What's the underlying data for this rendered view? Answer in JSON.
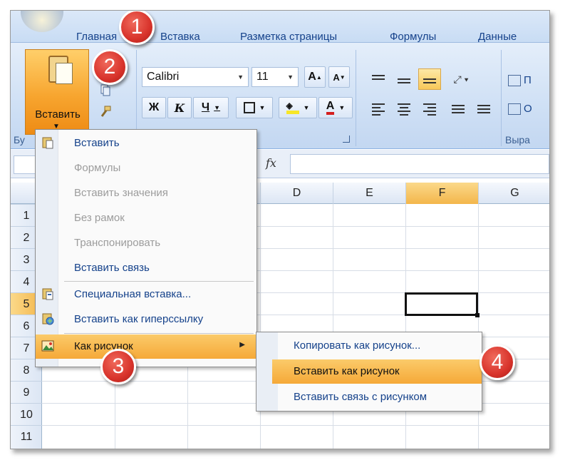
{
  "ribbon": {
    "tabs": [
      "Главная",
      "Вставка",
      "Разметка страницы",
      "Формулы",
      "Данные"
    ],
    "paste_button": "Вставить",
    "font_name": "Calibri",
    "font_size": "11",
    "grow_font": "A",
    "shrink_font": "A",
    "bold": "Ж",
    "italic": "К",
    "underline": "Ч",
    "clipboard_group_fragment": "Бу",
    "align_group_fragment": "Выра",
    "wrap_fragment": "П",
    "merge_fragment": "О",
    "font_color": "#d41f1f",
    "fill_color": "#f7e628"
  },
  "formula_bar": {
    "fx_label": "fx"
  },
  "grid": {
    "columns": [
      "D",
      "E",
      "F",
      "G"
    ],
    "selected_column": "F",
    "rows": [
      "1",
      "2",
      "3",
      "4",
      "5",
      "6",
      "7",
      "8",
      "9",
      "10",
      "11"
    ],
    "selected_row": "5"
  },
  "paste_menu": {
    "items": [
      {
        "label": "Вставить",
        "enabled": true,
        "icon": "paste-icon"
      },
      {
        "label": "Формулы",
        "enabled": false,
        "icon": ""
      },
      {
        "label": "Вставить значения",
        "enabled": false,
        "icon": ""
      },
      {
        "label": "Без рамок",
        "enabled": false,
        "icon": ""
      },
      {
        "label": "Транспонировать",
        "enabled": false,
        "icon": ""
      },
      {
        "label": "Вставить связь",
        "enabled": true,
        "icon": ""
      },
      {
        "label": "Специальная вставка...",
        "enabled": true,
        "icon": "paste-special-icon"
      },
      {
        "label": "Вставить как гиперссылку",
        "enabled": true,
        "icon": "paste-hyperlink-icon"
      },
      {
        "label": "Как рисунок",
        "enabled": true,
        "icon": "picture-icon",
        "highlighted": true
      }
    ]
  },
  "picture_submenu": {
    "items": [
      {
        "label": "Копировать как рисунок...",
        "highlighted": false
      },
      {
        "label": "Вставить как рисунок",
        "highlighted": true
      },
      {
        "label": "Вставить связь с рисунком",
        "highlighted": false
      }
    ]
  },
  "callouts": [
    "1",
    "2",
    "3",
    "4"
  ],
  "colors": {
    "accent_orange": "#f5a938",
    "callout_red": "#d8332b",
    "menu_text": "#15428b"
  }
}
